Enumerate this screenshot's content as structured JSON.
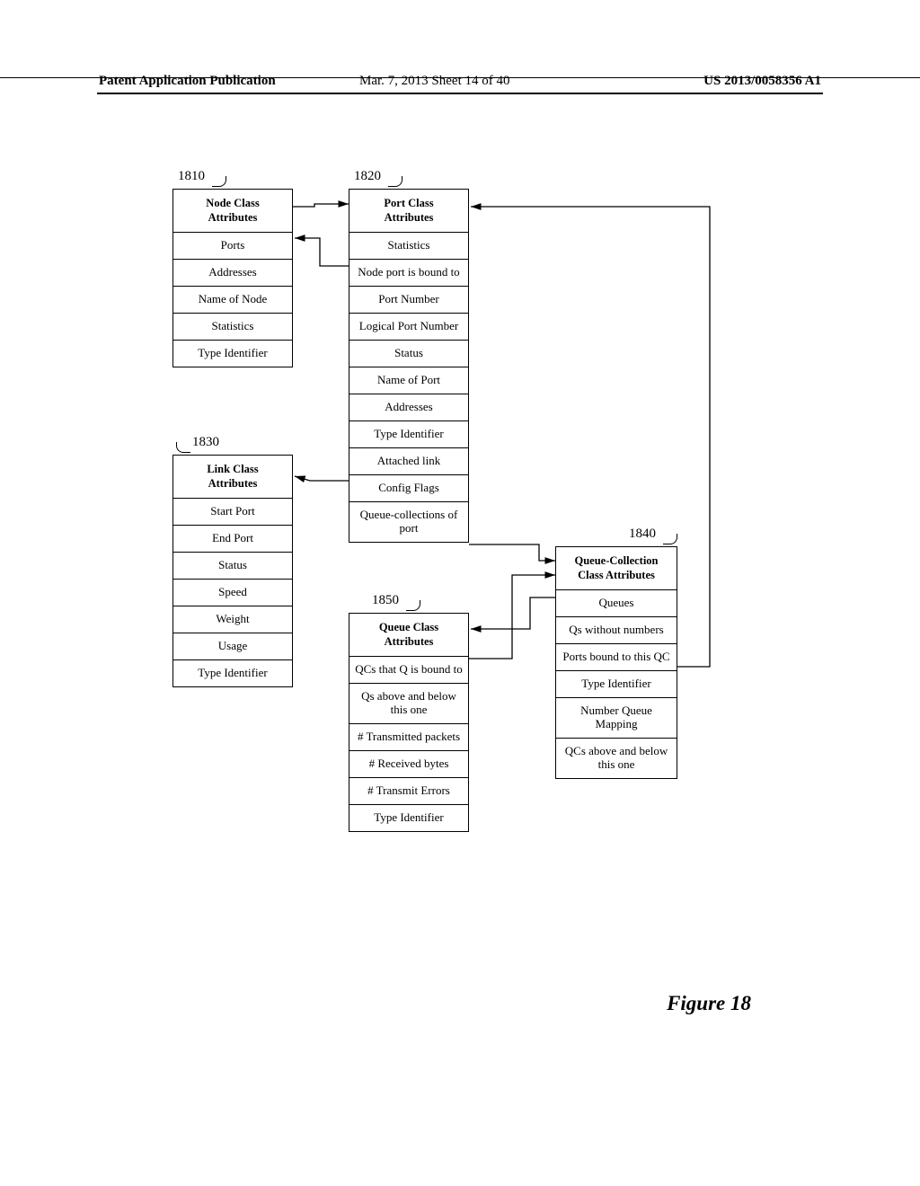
{
  "header": {
    "left": "Patent Application Publication",
    "center": "Mar. 7, 2013  Sheet 14 of 40",
    "right": "US 2013/0058356 A1"
  },
  "refs": {
    "node": "1810",
    "port": "1820",
    "link": "1830",
    "qc": "1840",
    "queue": "1850"
  },
  "node_class": {
    "title": "Node Class\nAttributes",
    "rows": [
      "Ports",
      "Addresses",
      "Name of Node",
      "Statistics",
      "Type Identifier"
    ]
  },
  "port_class": {
    "title": "Port Class\nAttributes",
    "rows": [
      "Statistics",
      "Node port is bound to",
      "Port Number",
      "Logical Port Number",
      "Status",
      "Name of Port",
      "Addresses",
      "Type Identifier",
      "Attached link",
      "Config Flags",
      "Queue-collections of port"
    ]
  },
  "link_class": {
    "title": "Link Class\nAttributes",
    "rows": [
      "Start Port",
      "End Port",
      "Status",
      "Speed",
      "Weight",
      "Usage",
      "Type Identifier"
    ]
  },
  "qc_class": {
    "title": "Queue-Collection\nClass Attributes",
    "rows": [
      "Queues",
      "Qs without numbers",
      "Ports bound to this QC",
      "Type Identifier",
      "Number Queue Mapping",
      "QCs above and below this one"
    ]
  },
  "queue_class": {
    "title": "Queue Class\nAttributes",
    "rows": [
      "QCs that Q is bound to",
      "Qs above and below this one",
      "# Transmitted packets",
      "# Received bytes",
      "# Transmit Errors",
      "Type Identifier"
    ]
  },
  "figure_caption": "Figure 18"
}
